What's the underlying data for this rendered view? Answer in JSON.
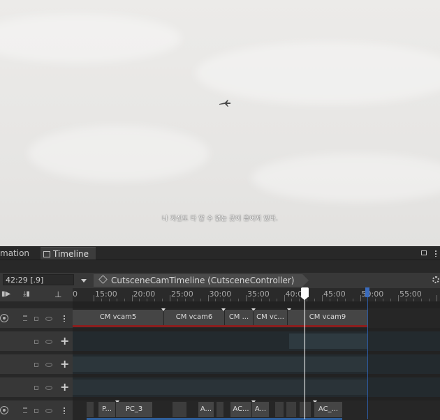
{
  "game_view": {
    "subtitle": "나 자신도 다 알 수 없는 곳이 흩어져 있다."
  },
  "panel": {
    "tabs": [
      {
        "label": "mation"
      },
      {
        "label": "Timeline"
      }
    ],
    "toolbar": {
      "time_value": "42:29 [.9]",
      "breadcrumb": "CutsceneCamTimeline (CutsceneController)"
    },
    "ruler": {
      "labels": [
        "0",
        "15:00",
        "20:00",
        "25:00",
        "30:00",
        "35:00",
        "40:00",
        "45:00",
        "50:00",
        "55:00"
      ],
      "playhead_time": "42:29"
    },
    "cinemachine_track": {
      "clips": [
        {
          "label": "CM vcam5"
        },
        {
          "label": "CM vcam6"
        },
        {
          "label": "CM ..."
        },
        {
          "label": "CM vc..."
        },
        {
          "label": "CM vcam9"
        }
      ]
    },
    "bottom_track": {
      "clips": [
        {
          "label": "P..."
        },
        {
          "label": "PC_3"
        },
        {
          "label": "A..."
        },
        {
          "label": "AC..."
        },
        {
          "label": "A..."
        },
        {
          "label": "AC_..."
        }
      ]
    }
  }
}
